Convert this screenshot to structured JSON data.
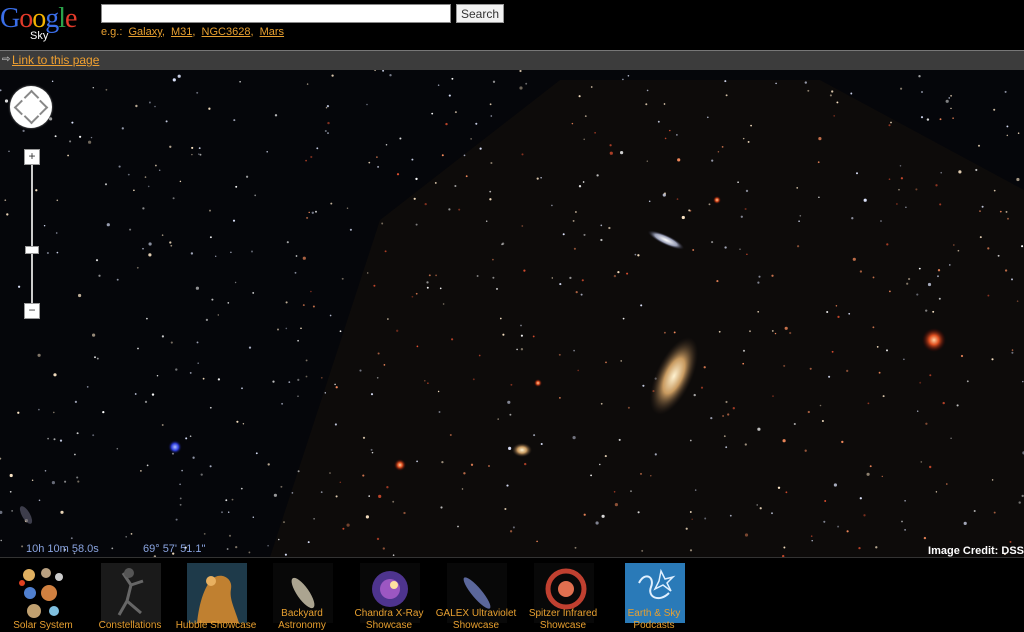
{
  "header": {
    "logo_text": "Google",
    "logo_sub": "Sky",
    "search_placeholder": "",
    "search_button": "Search",
    "examples_prefix": "e.g.:",
    "examples": [
      "Galaxy",
      "M31",
      "NGC3628",
      "Mars"
    ]
  },
  "linkbar": {
    "label": "Link to this page"
  },
  "map": {
    "ra": "10h 10m 58.0s",
    "dec": "69° 57' 51.1\"",
    "credit": "Image Credit: DSS"
  },
  "zoom": {
    "plus": "+",
    "minus": "−",
    "level_fraction": 0.62
  },
  "gallery": [
    {
      "label": "Solar System",
      "icon": "planets-icon"
    },
    {
      "label": "Constellations",
      "icon": "constellation-icon"
    },
    {
      "label": "Hubble Showcase",
      "icon": "hubble-icon"
    },
    {
      "label": "Backyard Astronomy",
      "icon": "galaxy-icon"
    },
    {
      "label": "Chandra X-Ray Showcase",
      "icon": "xray-icon"
    },
    {
      "label": "GALEX Ultraviolet Showcase",
      "icon": "ultraviolet-icon"
    },
    {
      "label": "Spitzer Infrared Showcase",
      "icon": "infrared-icon"
    },
    {
      "label": "Earth & Sky Podcasts",
      "icon": "podcast-icon"
    }
  ],
  "colors": {
    "accent": "#e8a030",
    "coord": "#8aa4e0",
    "sky": "#05060a"
  }
}
